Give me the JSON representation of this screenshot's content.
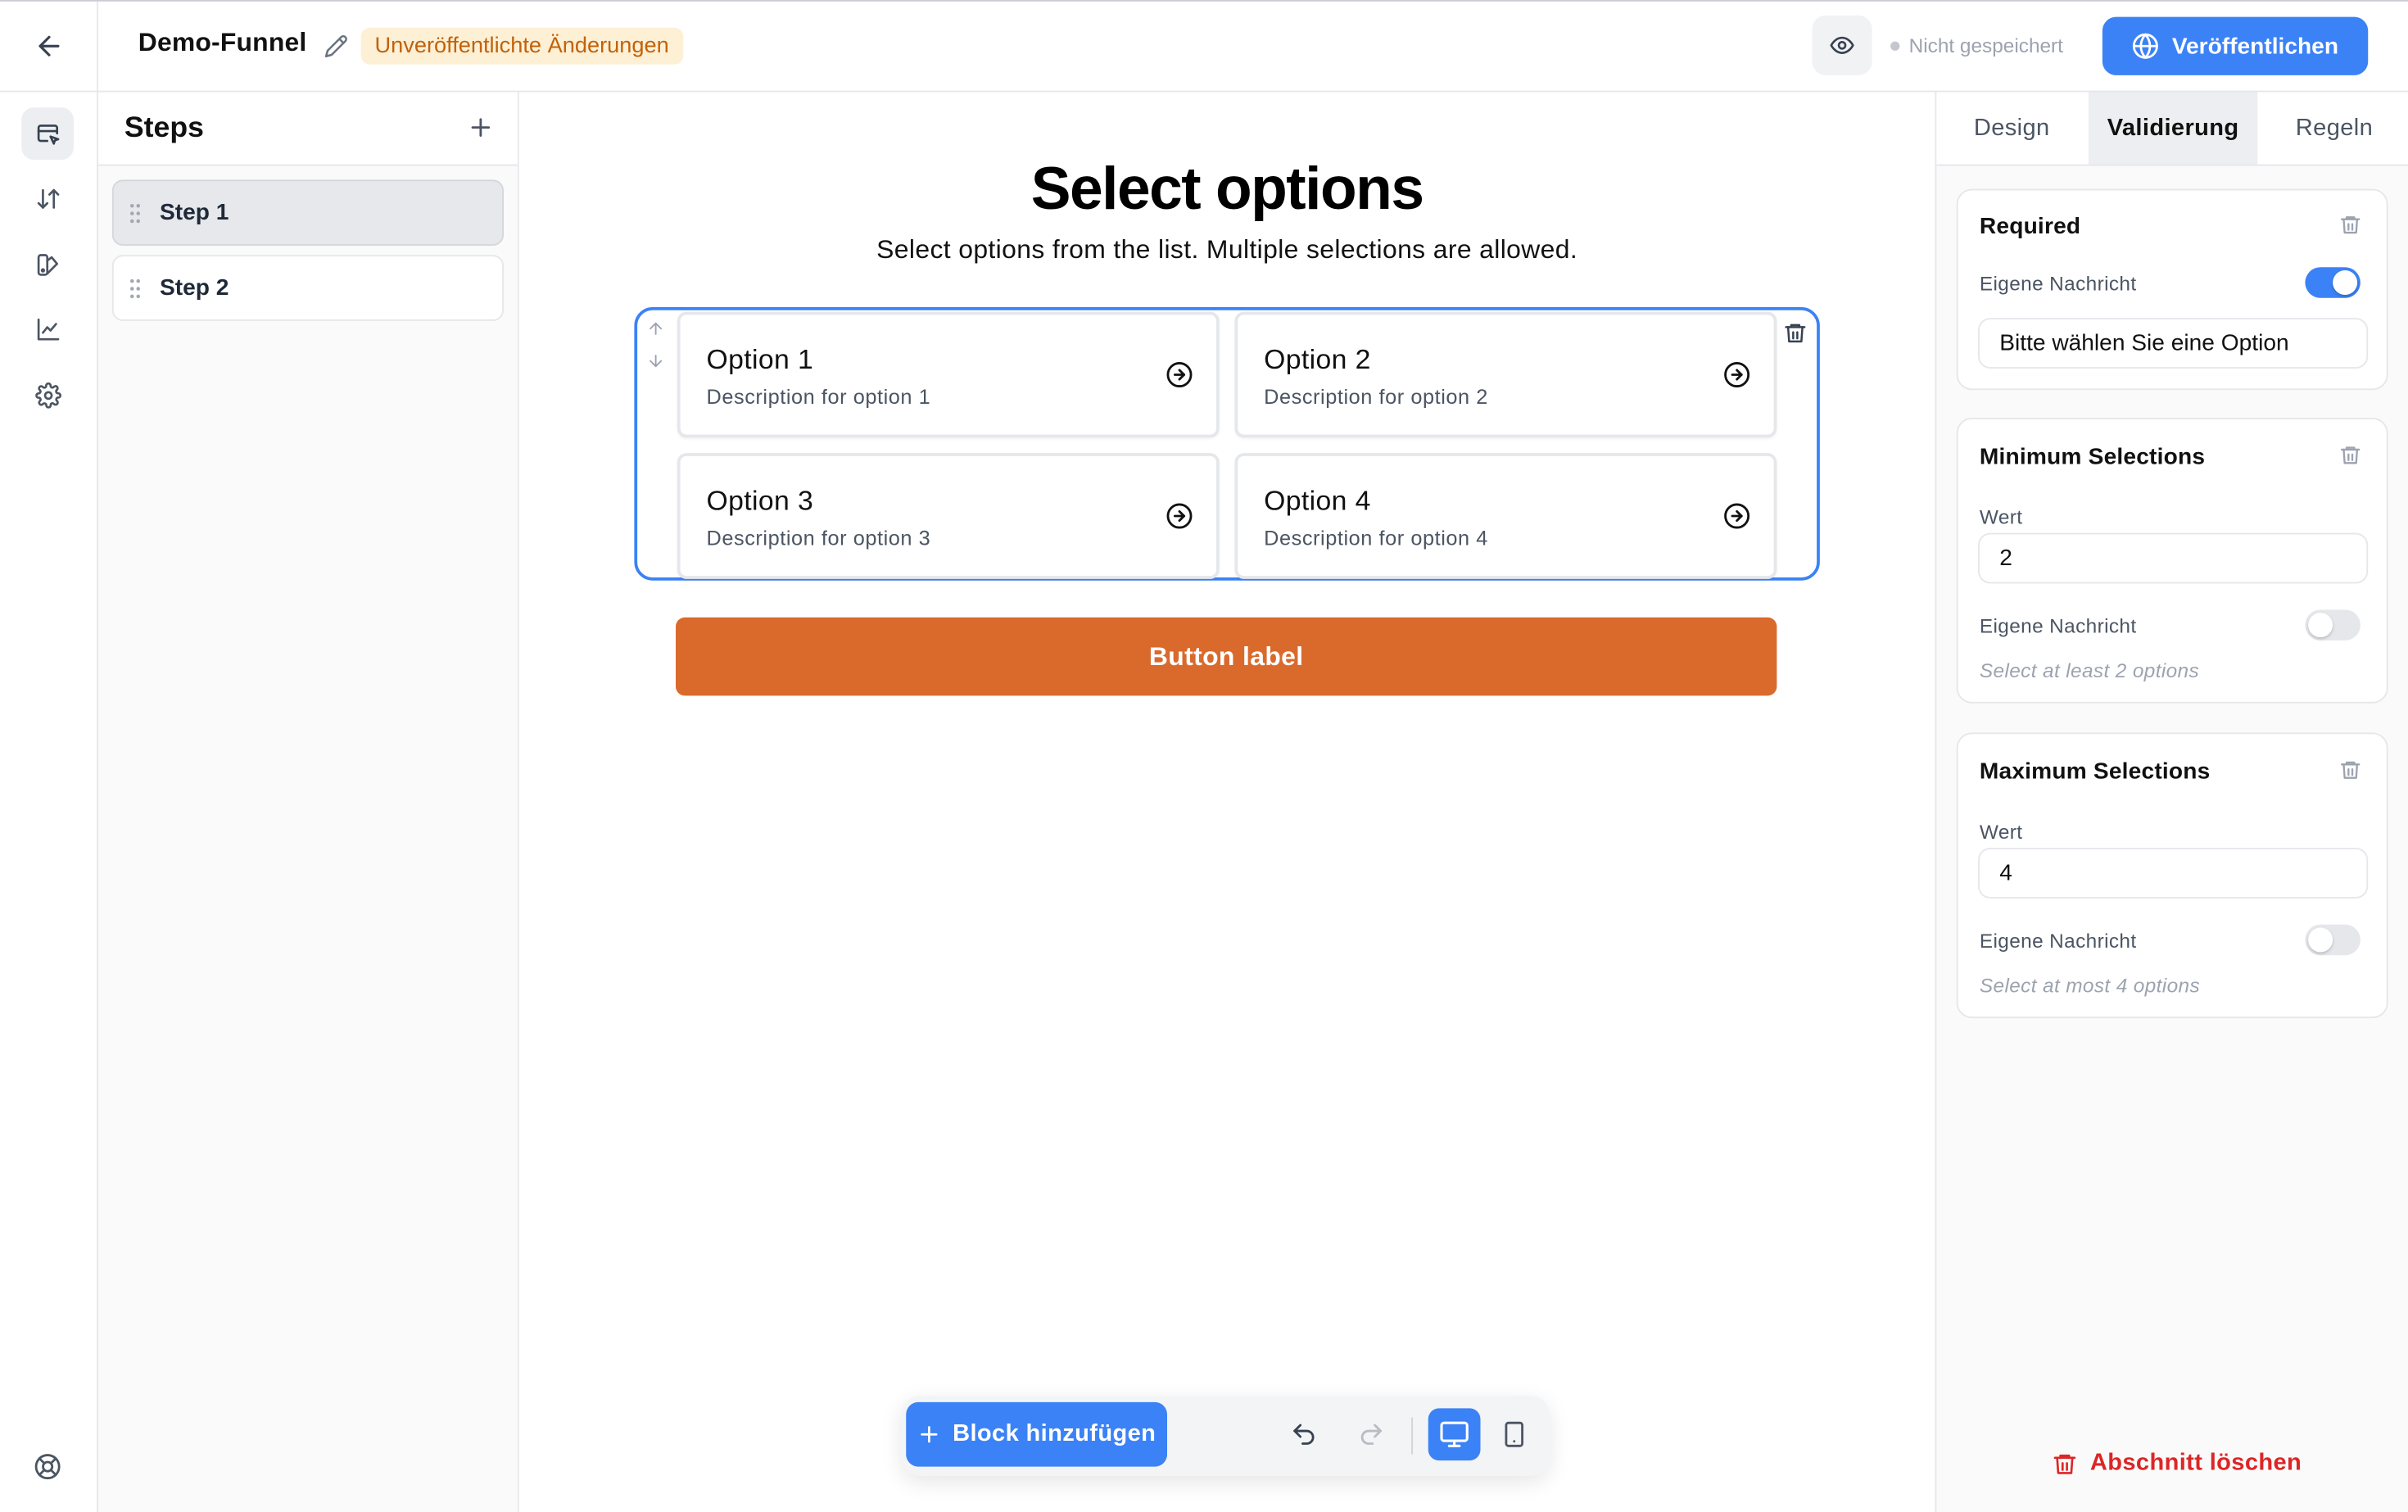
{
  "header": {
    "back_icon": "arrow-left-icon",
    "funnel_name": "Demo-Funnel",
    "edit_icon": "pencil-icon",
    "unsaved_badge": "Unveröffentlichte Änderungen",
    "preview_icon": "eye-icon",
    "save_status": "Nicht gespeichert",
    "publish_label": "Veröffentlichen",
    "publish_icon": "globe-icon"
  },
  "rail": {
    "items": [
      {
        "icon": "editor-icon",
        "active": true
      },
      {
        "icon": "arrows-up-down-icon",
        "active": false
      },
      {
        "icon": "palette-icon",
        "active": false
      },
      {
        "icon": "chart-icon",
        "active": false
      },
      {
        "icon": "gear-icon",
        "active": false
      }
    ],
    "bottom_icon": "help-lifebuoy-icon"
  },
  "steps": {
    "title": "Steps",
    "items": [
      {
        "label": "Step 1",
        "active": true
      },
      {
        "label": "Step 2",
        "active": false
      }
    ]
  },
  "canvas": {
    "title": "Select options",
    "subtitle": "Select options from the list. Multiple selections are allowed.",
    "options": [
      {
        "title": "Option 1",
        "description": "Description for option 1"
      },
      {
        "title": "Option 2",
        "description": "Description for option 2"
      },
      {
        "title": "Option 3",
        "description": "Description for option 3"
      },
      {
        "title": "Option 4",
        "description": "Description for option 4"
      }
    ],
    "button_label": "Button label",
    "button_color": "#d96a2c",
    "accent_color": "#3b82f6"
  },
  "toolbar": {
    "add_block_label": "Block hinzufügen",
    "undo_icon": "undo-icon",
    "redo_icon": "redo-icon",
    "desktop_icon": "desktop-icon",
    "mobile_icon": "mobile-icon",
    "active_device": "desktop"
  },
  "right_panel": {
    "tabs": [
      {
        "label": "Design",
        "active": false
      },
      {
        "label": "Validierung",
        "active": true
      },
      {
        "label": "Regeln",
        "active": false
      }
    ],
    "rules": {
      "required": {
        "title": "Required",
        "custom_message_label": "Eigene Nachricht",
        "custom_message_enabled": true,
        "message_value": "Bitte wählen Sie eine Option"
      },
      "min": {
        "title": "Minimum Selections",
        "value_label": "Wert",
        "value": "2",
        "custom_message_label": "Eigene Nachricht",
        "custom_message_enabled": false,
        "hint": "Select at least 2 options"
      },
      "max": {
        "title": "Maximum Selections",
        "value_label": "Wert",
        "value": "4",
        "custom_message_label": "Eigene Nachricht",
        "custom_message_enabled": false,
        "hint": "Select at most 4 options"
      }
    },
    "delete_section_label": "Abschnitt löschen"
  }
}
